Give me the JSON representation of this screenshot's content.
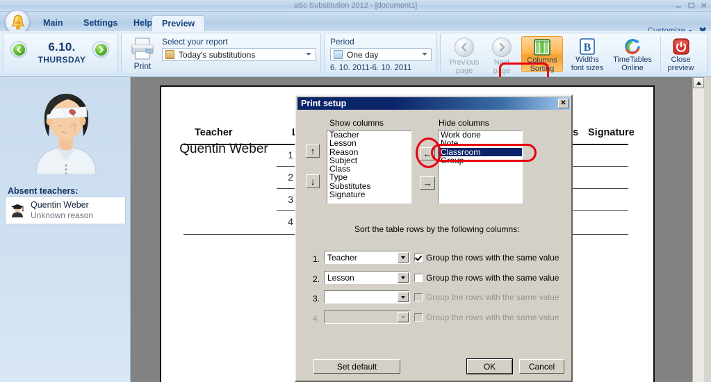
{
  "window": {
    "title": "aSc Substitution 2012  - [document1]",
    "controls": [
      {
        "name": "minimize",
        "glyph": "minimize-icon"
      },
      {
        "name": "maximize",
        "glyph": "maximize-icon"
      },
      {
        "name": "close",
        "glyph": "close-icon"
      }
    ]
  },
  "ribbon": {
    "tabs": [
      {
        "label": "Main",
        "active": false
      },
      {
        "label": "Settings",
        "active": false
      },
      {
        "label": "Help",
        "active": false
      },
      {
        "label": "Preview",
        "active": true
      }
    ],
    "customize_label": "Customize",
    "close_ribbon_glyph": "✖",
    "date_group": {
      "prev_icon": "left-arrow-icon",
      "next_icon": "right-arrow-icon",
      "date": "6.10.",
      "weekday": "THURSDAY"
    },
    "print_group": {
      "print_label": "Print",
      "print_icon": "printer-icon",
      "report_caption": "Select your report",
      "report_value": "Today's substitutions",
      "report_icon": "report-file-icon"
    },
    "period_group": {
      "caption": "Period",
      "value": "One day",
      "icon": "calendar-icon",
      "range": "6. 10. 2011-6. 10. 2011"
    },
    "commands": [
      {
        "name": "previous-page",
        "line1": "Previous",
        "line2": "page",
        "icon": "back-arrow-icon",
        "disabled": true
      },
      {
        "name": "next-page",
        "line1": "Next",
        "line2": "page",
        "icon": "forward-arrow-icon",
        "disabled": true
      },
      {
        "name": "columns-sorting",
        "line1": "Columns",
        "line2": "Sorting",
        "icon": "table-columns-icon",
        "disabled": false,
        "highlighted": true
      },
      {
        "name": "widths-font-sizes",
        "line1": "Widths",
        "line2": "font sizes",
        "icon": "bold-b-icon",
        "disabled": false
      },
      {
        "name": "timetables-online",
        "line1": "TimeTables",
        "line2": "Online",
        "icon": "sync-cloud-icon",
        "disabled": false
      },
      {
        "name": "close-preview",
        "line1": "Close",
        "line2": "preview",
        "icon": "power-icon",
        "disabled": false
      }
    ]
  },
  "sidebar": {
    "avatar_icon": "injured-teacher-avatar",
    "absent_label": "Absent teachers:",
    "absent_teachers": [
      {
        "name": "Quentin Weber",
        "reason": "Unknown reason",
        "icon": "graduate-icon"
      }
    ]
  },
  "preview": {
    "table_headers": [
      "Teacher",
      "Lesson",
      "...es",
      "Signature"
    ],
    "teacher_cell": "Quentin Weber",
    "lessons": [
      "1",
      "2",
      "3",
      "4"
    ]
  },
  "dialog": {
    "title": "Print setup",
    "close_glyph": "✕",
    "show_columns_label": "Show columns",
    "hide_columns_label": "Hide columns",
    "show_columns": [
      "Teacher",
      "Lesson",
      "Reason",
      "Subject",
      "Class",
      "Type",
      "Substitutes",
      "Signature"
    ],
    "hide_columns": [
      {
        "label": "Work done",
        "selected": false
      },
      {
        "label": "Note",
        "selected": false
      },
      {
        "label": "Classroom",
        "selected": true
      },
      {
        "label": "Group",
        "selected": false
      }
    ],
    "move_up_glyph": "↑",
    "move_down_glyph": "↓",
    "move_left_glyph": "←",
    "move_right_glyph": "→",
    "sort_caption": "Sort the table rows by the following columns:",
    "sort_rows": [
      {
        "index": "1.",
        "value": "Teacher",
        "checked": true,
        "disabled": false,
        "group_label": "Group the rows with the same value"
      },
      {
        "index": "2.",
        "value": "Lesson",
        "checked": false,
        "disabled": false,
        "group_label": "Group the rows with the same value"
      },
      {
        "index": "3.",
        "value": "",
        "checked": false,
        "disabled": true,
        "group_label": "Group the rows with the same value"
      },
      {
        "index": "4.",
        "value": "",
        "checked": false,
        "disabled": true,
        "group_label": "Group the rows with the same value"
      }
    ],
    "buttons": {
      "set_default": "Set default",
      "ok": "OK",
      "cancel": "Cancel"
    }
  },
  "annotations": {
    "color": "#e8000d",
    "targets": [
      "columns-sorting-button",
      "move-left-button",
      "classroom-list-item"
    ]
  },
  "scrollbar": {
    "up_glyph": "▲"
  }
}
